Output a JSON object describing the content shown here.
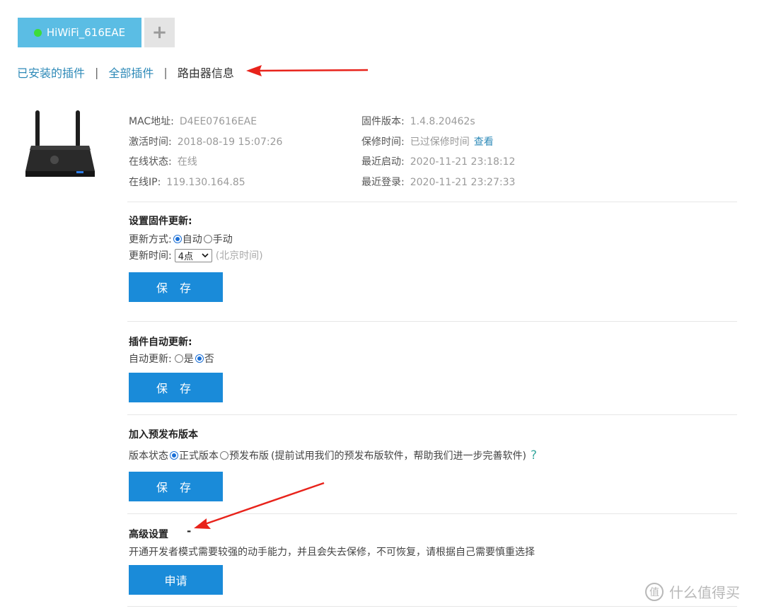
{
  "device_tab": {
    "label": "HiWiFi_616EAE",
    "status_color": "#3ddc3a"
  },
  "add_tab": {
    "label": "+"
  },
  "nav": {
    "installed": "已安装的插件",
    "all": "全部插件",
    "router_info": "路由器信息",
    "separator": "|"
  },
  "info": {
    "mac_label": "MAC地址:",
    "mac_value": "D4EE07616EAE",
    "activate_label": "激活时间:",
    "activate_value": "2018-08-19 15:07:26",
    "online_label": "在线状态:",
    "online_value": "在线",
    "ip_label": "在线IP:",
    "ip_value": "119.130.164.85",
    "firmware_label": "固件版本:",
    "firmware_value": "1.4.8.20462s",
    "warranty_label": "保修时间:",
    "warranty_value": "已过保修时间",
    "warranty_link": "查看",
    "boot_label": "最近启动:",
    "boot_value": "2020-11-21 23:18:12",
    "login_label": "最近登录:",
    "login_value": "2020-11-21 23:27:33"
  },
  "firmware_update": {
    "title": "设置固件更新:",
    "mode_label": "更新方式:",
    "auto": "自动",
    "manual": "手动",
    "selected": "auto",
    "time_label": "更新时间:",
    "time_value": "4点",
    "time_hint": "(北京时间)",
    "save": "保 存"
  },
  "plugin_update": {
    "title": "插件自动更新:",
    "label": "自动更新:",
    "yes": "是",
    "no": "否",
    "selected": "no",
    "save": "保 存"
  },
  "prerelease": {
    "title": "加入预发布版本",
    "label": "版本状态",
    "official": "正式版本",
    "pre": "预发布版",
    "selected": "official",
    "desc": "(提前试用我们的预发布版软件，帮助我们进一步完善软件)",
    "help": "?",
    "save": "保 存"
  },
  "advanced": {
    "title": "高级设置",
    "toggle": "-",
    "desc": "开通开发者模式需要较强的动手能力，并且会失去保修，不可恢复，请根据自己需要慎重选择",
    "apply": "申请"
  },
  "watermark": {
    "icon": "值",
    "text": "什么值得买"
  },
  "colors": {
    "accent": "#1a8bd9",
    "link": "#2e8ab8",
    "annotation": "#e8231b"
  }
}
